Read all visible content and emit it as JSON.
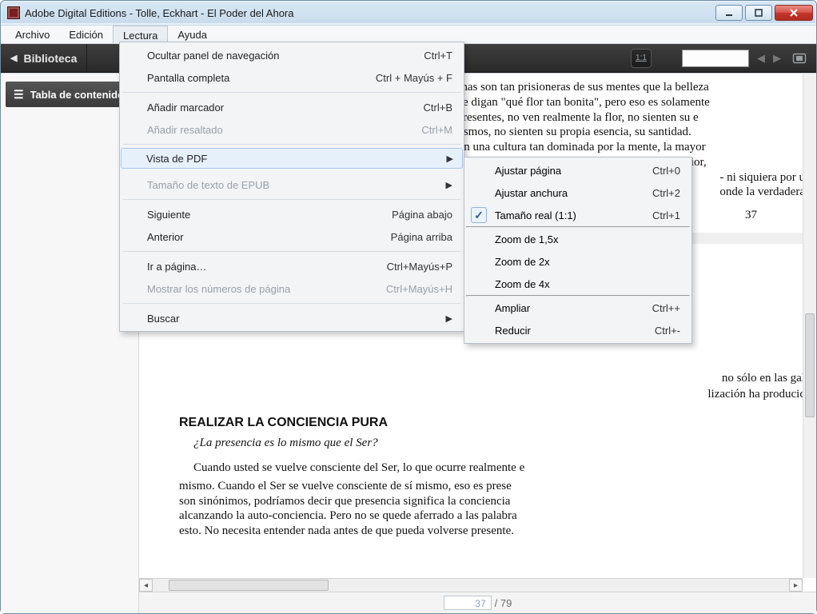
{
  "window": {
    "title": "Adobe Digital Editions - Tolle, Eckhart - El Poder del Ahora"
  },
  "menubar": {
    "file": "Archivo",
    "edit": "Edición",
    "read": "Lectura",
    "help": "Ayuda"
  },
  "toolbar": {
    "library": "Biblioteca",
    "toc": "Tabla de contenidos"
  },
  "dropdown": {
    "hide_nav": "Ocultar panel de navegación",
    "hide_nav_k": "Ctrl+T",
    "fullscreen": "Pantalla completa",
    "fullscreen_k": "Ctrl + Mayús + F",
    "add_bookmark": "Añadir marcador",
    "add_bookmark_k": "Ctrl+B",
    "add_highlight": "Añadir resaltado",
    "add_highlight_k": "Ctrl+M",
    "pdf_view": "Vista de PDF",
    "epub_size": "Tamaño de texto de EPUB",
    "next": "Siguiente",
    "next_k": "Página abajo",
    "prev": "Anterior",
    "prev_k": "Página arriba",
    "goto": "Ir a página…",
    "goto_k": "Ctrl+Mayús+P",
    "show_pagenums": "Mostrar los números de página",
    "show_pagenums_k": "Ctrl+Mayús+H",
    "search": "Buscar"
  },
  "submenu": {
    "fit_page": "Ajustar página",
    "fit_page_k": "Ctrl+0",
    "fit_width": "Ajustar anchura",
    "fit_width_k": "Ctrl+2",
    "actual": "Tamaño real (1:1)",
    "actual_k": "Ctrl+1",
    "z15": "Zoom de 1,5x",
    "z2": "Zoom de 2x",
    "z4": "Zoom de 4x",
    "zoom_in": "Ampliar",
    "zoom_in_k": "Ctrl++",
    "zoom_out": "Reducir",
    "zoom_out_k": "Ctrl+-"
  },
  "doc": {
    "page_number": "37",
    "par1": "sonas son tan prisioneras de sus mentes que la belleza",
    "par2": "que digan \"qué flor tan bonita\", pero eso es solamente",
    "par3": ", presentes, no ven realmente la flor, no sienten su e",
    "par4": "mismos, no sienten su propia esencia, su santidad.",
    "par5": "s en una cultura tan dominada por la mente, la mayor",
    "par6": "teratura están privadas de belleza, de esencia interior,",
    "par7": "- ni siquiera por u",
    "par8": "onde la verdadera",
    "heading": "REALIZAR LA CONCIENCIA PURA",
    "question": "¿La presencia es lo mismo que el Ser?",
    "body1": "Cuando usted se vuelve consciente del Ser, lo que ocurre realmente e",
    "body2": "mismo. Cuando el Ser se vuelve consciente de sí mismo, eso es prese",
    "body3": "son sinónimos, podríamos decir que presencia significa la conciencia",
    "body4": "alcanzando la auto-conciencia. Pero no se quede aferrado a las palabra",
    "body5": "esto. No necesita entender nada antes de que pueda volverse presente.",
    "frag_gal": "no sólo en las gal",
    "frag_civ": "lización ha producic"
  },
  "pager": {
    "current": "37",
    "total": " / 79"
  }
}
